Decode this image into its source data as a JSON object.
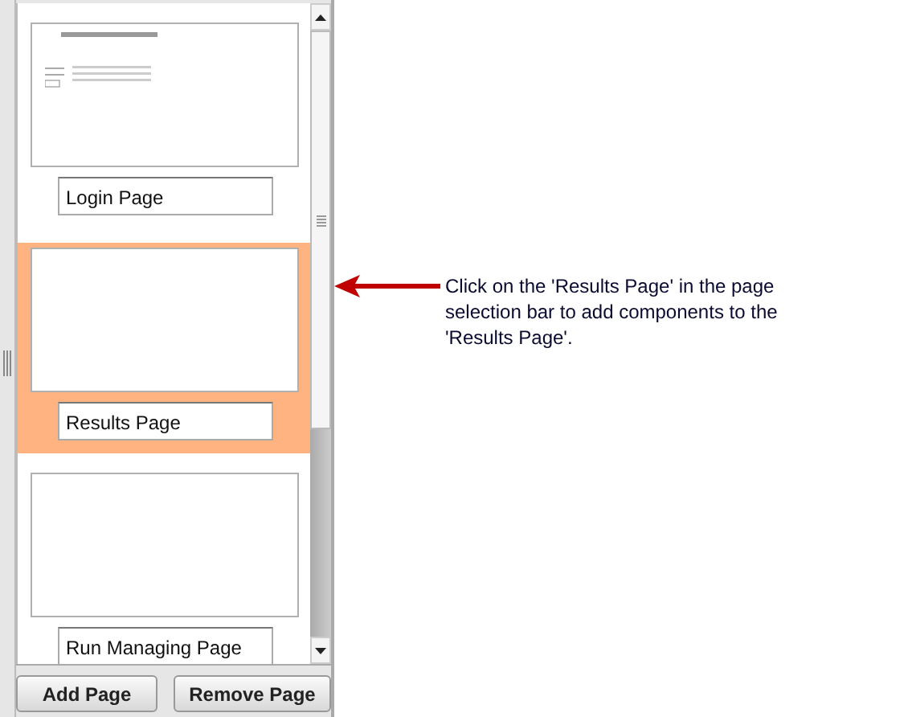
{
  "pages": [
    {
      "label": "Login Page",
      "selected": false,
      "kind": "form"
    },
    {
      "label": "Results Page",
      "selected": true,
      "kind": "blank"
    },
    {
      "label": "Run Managing Page",
      "selected": false,
      "kind": "blank"
    }
  ],
  "buttons": [
    "Add Page",
    "Remove Page"
  ],
  "callout": "Click on the 'Results Page' in the page selection bar to add components to the 'Results Page'."
}
